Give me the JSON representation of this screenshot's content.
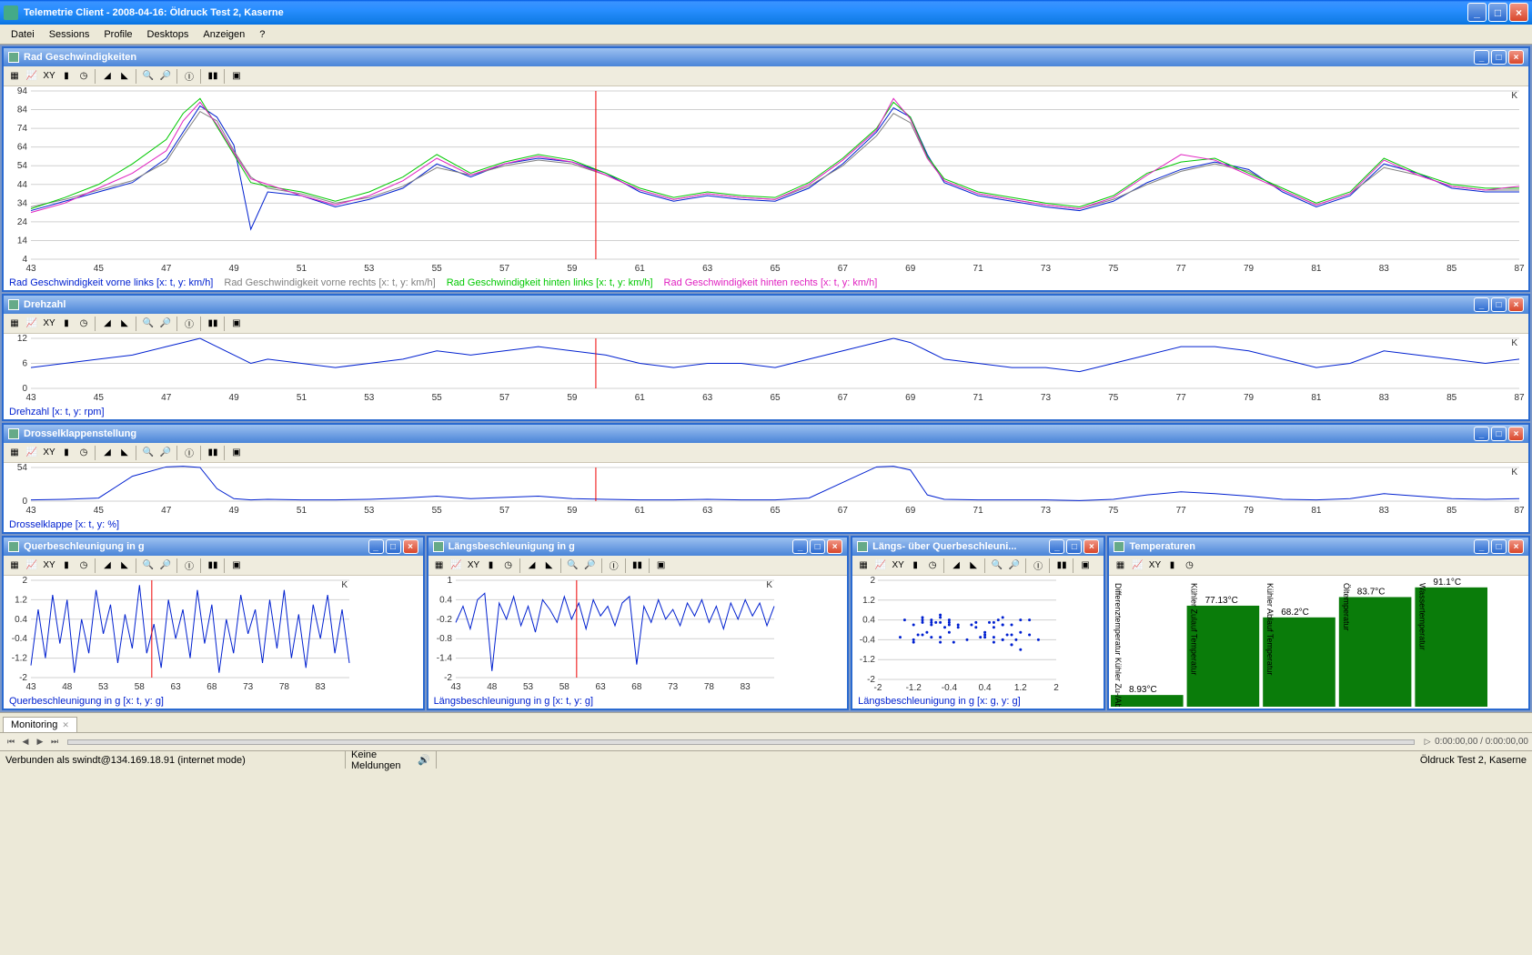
{
  "window": {
    "title": "Telemetrie Client - 2008-04-16: Öldruck Test 2, Kaserne"
  },
  "menu": [
    "Datei",
    "Sessions",
    "Profile",
    "Desktops",
    "Anzeigen",
    "?"
  ],
  "x_axis": {
    "min": 43,
    "max": 87,
    "ticks": [
      43,
      45,
      47,
      49,
      51,
      53,
      55,
      57,
      59,
      61,
      63,
      65,
      67,
      69,
      71,
      73,
      75,
      77,
      79,
      81,
      83,
      85,
      87
    ],
    "cursor": 59.7,
    "unit": "K"
  },
  "panels": {
    "speed": {
      "title": "Rad Geschwindigkeiten",
      "y": {
        "min": 4,
        "max": 94,
        "ticks": [
          4,
          14,
          24,
          34,
          44,
          54,
          64,
          74,
          84,
          94
        ]
      },
      "legend": [
        {
          "label": "Rad Geschwindigkeit vorne links [x: t, y: km/h]",
          "color": "#0020d0"
        },
        {
          "label": "Rad Geschwindigkeit vorne rechts [x: t, y: km/h]",
          "color": "#808080"
        },
        {
          "label": "Rad Geschwindigkeit hinten links [x: t, y: km/h]",
          "color": "#00c800"
        },
        {
          "label": "Rad Geschwindigkeit hinten rechts [x: t, y: km/h]",
          "color": "#e020c0"
        }
      ]
    },
    "rpm": {
      "title": "Drehzahl",
      "y": {
        "min": 0,
        "max": 12,
        "ticks": [
          0,
          6,
          12
        ]
      },
      "legend": [
        {
          "label": "Drehzahl [x: t, y: rpm]",
          "color": "#0020d0"
        }
      ]
    },
    "throttle": {
      "title": "Drosselklappenstellung",
      "y": {
        "min": 0,
        "max": 54,
        "ticks": [
          0,
          54
        ]
      },
      "legend": [
        {
          "label": "Drosselklappe [x: t, y: %]",
          "color": "#0020d0"
        }
      ]
    },
    "lat": {
      "title": "Querbeschleunigung in g",
      "y": {
        "min": -2,
        "max": 2,
        "ticks": [
          -2,
          -1.2,
          -0.4,
          0.4,
          1.2,
          2
        ]
      },
      "x_ticks": [
        43,
        48,
        53,
        58,
        63,
        68,
        73,
        78,
        83
      ],
      "legend": [
        {
          "label": "Querbeschleunigung in g [x: t, y: g]",
          "color": "#0020d0"
        }
      ]
    },
    "lon": {
      "title": "Längsbeschleunigung in g",
      "y": {
        "min": -2,
        "max": 1,
        "ticks": [
          -2,
          -1.4,
          -0.8,
          -0.2,
          0.4,
          1
        ]
      },
      "x_ticks": [
        43,
        48,
        53,
        58,
        63,
        68,
        73,
        78,
        83
      ],
      "legend": [
        {
          "label": "Längsbeschleunigung in g [x: t, y: g]",
          "color": "#0020d0"
        }
      ]
    },
    "scatter": {
      "title": "Längs- über Querbeschleuni...",
      "x": {
        "min": -2,
        "max": 2,
        "ticks": [
          -2,
          -1.2,
          -0.4,
          0.4,
          1.2,
          2
        ]
      },
      "y": {
        "min": -2,
        "max": 2,
        "ticks": [
          -2,
          -1.2,
          -0.4,
          0.4,
          1.2,
          2
        ]
      },
      "legend": [
        {
          "label": "Längsbeschleunigung in g [x: g, y: g]",
          "color": "#0020d0"
        }
      ]
    },
    "temp": {
      "title": "Temperaturen",
      "bars": [
        {
          "label": "Differenztemperatur Kühler Zu-/Ab",
          "value": 8.93,
          "text": "8.93°C"
        },
        {
          "label": "Kühler Zulauf Temperatur",
          "value": 77.13,
          "text": "77.13°C"
        },
        {
          "label": "Kühler Ablauf Temperatur",
          "value": 68.2,
          "text": "68.2°C"
        },
        {
          "label": "Öltemperatur",
          "value": 83.7,
          "text": "83.7°C"
        },
        {
          "label": "Wassertemperatur",
          "value": 91.1,
          "text": "91.1°C"
        }
      ],
      "max": 100
    }
  },
  "tabs": {
    "active": "Monitoring"
  },
  "playback": {
    "time": "0:00:00,00 / 0:00:00,00"
  },
  "status": {
    "conn": "Verbunden als swindt@134.169.18.91 (internet mode)",
    "msg": "Keine Meldungen",
    "right": "Öldruck Test 2, Kaserne"
  },
  "chart_data": {
    "type": "line_multi",
    "shared_x": [
      43,
      44,
      45,
      46,
      47,
      47.5,
      48,
      48.5,
      49,
      49.5,
      50,
      51,
      52,
      53,
      54,
      55,
      56,
      57,
      58,
      59,
      60,
      61,
      62,
      63,
      64,
      65,
      66,
      67,
      68,
      68.5,
      69,
      69.5,
      70,
      71,
      72,
      73,
      74,
      75,
      76,
      77,
      78,
      79,
      80,
      81,
      82,
      83,
      84,
      85,
      86,
      87
    ],
    "speed_series": [
      {
        "name": "vorne links",
        "color": "#0020d0",
        "y": [
          30,
          35,
          40,
          45,
          58,
          72,
          86,
          80,
          65,
          20,
          40,
          38,
          32,
          36,
          42,
          55,
          48,
          55,
          58,
          56,
          50,
          40,
          35,
          38,
          36,
          35,
          42,
          55,
          72,
          85,
          80,
          60,
          45,
          38,
          35,
          32,
          30,
          35,
          45,
          52,
          56,
          52,
          40,
          32,
          38,
          55,
          50,
          42,
          40,
          40
        ]
      },
      {
        "name": "vorne rechts",
        "color": "#808080",
        "y": [
          32,
          36,
          41,
          46,
          56,
          70,
          83,
          78,
          62,
          48,
          42,
          39,
          34,
          37,
          43,
          53,
          49,
          54,
          57,
          55,
          49,
          41,
          36,
          39,
          37,
          36,
          43,
          54,
          70,
          82,
          77,
          58,
          46,
          39,
          36,
          33,
          31,
          36,
          44,
          51,
          55,
          51,
          41,
          33,
          39,
          53,
          49,
          43,
          41,
          41
        ]
      },
      {
        "name": "hinten links",
        "color": "#00c800",
        "y": [
          31,
          37,
          44,
          55,
          68,
          82,
          90,
          75,
          60,
          45,
          43,
          40,
          35,
          40,
          48,
          60,
          50,
          56,
          60,
          57,
          50,
          42,
          37,
          40,
          38,
          37,
          45,
          58,
          74,
          88,
          80,
          59,
          47,
          40,
          37,
          34,
          32,
          38,
          50,
          56,
          58,
          50,
          42,
          34,
          40,
          58,
          50,
          44,
          42,
          42
        ]
      },
      {
        "name": "hinten rechts",
        "color": "#e020c0",
        "y": [
          29,
          34,
          42,
          50,
          62,
          78,
          88,
          76,
          61,
          47,
          44,
          38,
          33,
          38,
          46,
          58,
          49,
          55,
          59,
          56,
          49,
          41,
          36,
          39,
          37,
          36,
          44,
          57,
          73,
          90,
          79,
          58,
          46,
          39,
          36,
          33,
          31,
          37,
          49,
          60,
          57,
          49,
          41,
          33,
          39,
          57,
          49,
          43,
          41,
          43
        ]
      }
    ],
    "rpm": {
      "name": "Drehzahl",
      "color": "#0020d0",
      "y": [
        5,
        6,
        7,
        8,
        10,
        11,
        12,
        10,
        8,
        6,
        7,
        6,
        5,
        6,
        7,
        9,
        8,
        9,
        10,
        9,
        8,
        6,
        5,
        6,
        6,
        5,
        7,
        9,
        11,
        12,
        11,
        9,
        7,
        6,
        5,
        5,
        4,
        6,
        8,
        10,
        10,
        9,
        7,
        5,
        6,
        9,
        8,
        7,
        6,
        7
      ]
    },
    "throttle": {
      "name": "Drosselklappe",
      "color": "#0020d0",
      "y": [
        2,
        3,
        5,
        40,
        55,
        56,
        54,
        20,
        4,
        2,
        3,
        2,
        2,
        3,
        5,
        8,
        4,
        6,
        8,
        4,
        3,
        2,
        2,
        3,
        2,
        2,
        5,
        30,
        55,
        56,
        50,
        10,
        3,
        2,
        2,
        2,
        1,
        3,
        10,
        15,
        12,
        8,
        3,
        2,
        4,
        12,
        8,
        4,
        3,
        4
      ]
    },
    "lat_g": {
      "name": "Querbeschleunigung",
      "color": "#0020d0",
      "x": [
        43,
        44,
        45,
        46,
        47,
        48,
        49,
        50,
        51,
        52,
        53,
        54,
        55,
        56,
        57,
        58,
        59,
        60,
        61,
        62,
        63,
        64,
        65,
        66,
        67,
        68,
        69,
        70,
        71,
        72,
        73,
        74,
        75,
        76,
        77,
        78,
        79,
        80,
        81,
        82,
        83,
        84,
        85,
        86,
        87
      ],
      "y": [
        -1.5,
        0.8,
        -1.2,
        1.4,
        -0.6,
        1.2,
        -1.8,
        0.4,
        -1.0,
        1.6,
        -0.2,
        1.0,
        -1.4,
        0.6,
        -0.8,
        1.8,
        -1.0,
        0.2,
        -1.6,
        1.2,
        -0.4,
        0.8,
        -1.2,
        1.6,
        -0.6,
        1.0,
        -1.8,
        0.4,
        -1.0,
        1.4,
        -0.2,
        0.8,
        -1.4,
        1.2,
        -0.8,
        1.6,
        -1.2,
        0.6,
        -1.6,
        1.0,
        -0.4,
        1.4,
        -1.0,
        0.8,
        -1.4
      ]
    },
    "lon_g": {
      "name": "Längsbeschleunigung",
      "color": "#0020d0",
      "x": [
        43,
        44,
        45,
        46,
        47,
        48,
        49,
        50,
        51,
        52,
        53,
        54,
        55,
        56,
        57,
        58,
        59,
        60,
        61,
        62,
        63,
        64,
        65,
        66,
        67,
        68,
        69,
        70,
        71,
        72,
        73,
        74,
        75,
        76,
        77,
        78,
        79,
        80,
        81,
        82,
        83,
        84,
        85,
        86,
        87
      ],
      "y": [
        -0.3,
        0.2,
        -0.5,
        0.4,
        0.6,
        -1.8,
        0.3,
        -0.2,
        0.5,
        -0.4,
        0.2,
        -0.6,
        0.4,
        0.1,
        -0.3,
        0.5,
        -0.2,
        0.3,
        -0.5,
        0.4,
        -0.1,
        0.2,
        -0.4,
        0.3,
        0.5,
        -1.6,
        0.2,
        -0.3,
        0.4,
        -0.2,
        0.1,
        -0.4,
        0.3,
        -0.1,
        0.4,
        -0.3,
        0.2,
        -0.5,
        0.3,
        -0.2,
        0.4,
        -0.1,
        0.3,
        -0.4,
        0.2
      ]
    },
    "scatter": {
      "name": "Längs über Quer",
      "color": "#0020d0",
      "points": [
        [
          -1.5,
          -0.3
        ],
        [
          0.8,
          0.2
        ],
        [
          -1.2,
          -0.5
        ],
        [
          1.4,
          0.4
        ],
        [
          -0.6,
          0.6
        ],
        [
          1.2,
          -0.8
        ],
        [
          -0.8,
          0.3
        ],
        [
          0.4,
          -0.2
        ],
        [
          -1.0,
          0.5
        ],
        [
          1.6,
          -0.4
        ],
        [
          -0.2,
          0.2
        ],
        [
          1.0,
          -0.6
        ],
        [
          -1.4,
          0.4
        ],
        [
          0.6,
          0.1
        ],
        [
          -0.8,
          -0.3
        ],
        [
          0.8,
          0.5
        ],
        [
          -1.0,
          -0.2
        ],
        [
          0.2,
          0.3
        ],
        [
          -0.6,
          -0.5
        ],
        [
          1.2,
          0.4
        ],
        [
          -0.4,
          -0.1
        ],
        [
          0.8,
          0.2
        ],
        [
          -1.2,
          -0.4
        ],
        [
          0.6,
          0.3
        ],
        [
          -0.6,
          0.5
        ],
        [
          1.0,
          -0.6
        ],
        [
          -0.8,
          0.2
        ],
        [
          0.4,
          -0.3
        ],
        [
          -1.0,
          0.4
        ],
        [
          1.4,
          -0.2
        ],
        [
          -0.2,
          0.1
        ],
        [
          0.8,
          -0.4
        ],
        [
          -0.4,
          0.3
        ],
        [
          1.2,
          -0.1
        ],
        [
          -0.8,
          0.4
        ],
        [
          0.6,
          -0.3
        ],
        [
          -1.2,
          0.2
        ],
        [
          0.6,
          -0.5
        ],
        [
          -0.6,
          0.3
        ],
        [
          1.0,
          -0.2
        ],
        [
          -0.4,
          0.4
        ],
        [
          0.4,
          -0.1
        ],
        [
          -1.0,
          0.3
        ],
        [
          0.8,
          -0.4
        ],
        [
          -0.4,
          0.2
        ],
        [
          0.3,
          -0.3
        ],
        [
          -0.5,
          0.1
        ],
        [
          0.9,
          -0.2
        ],
        [
          -0.7,
          0.3
        ],
        [
          1.1,
          -0.4
        ],
        [
          0.1,
          0.2
        ],
        [
          -0.9,
          -0.1
        ],
        [
          0.5,
          0.3
        ],
        [
          -0.3,
          -0.5
        ],
        [
          0.7,
          0.4
        ],
        [
          -1.1,
          -0.2
        ],
        [
          0.2,
          0.1
        ],
        [
          -0.6,
          -0.3
        ],
        [
          1.0,
          0.2
        ],
        [
          0.0,
          -0.4
        ]
      ]
    }
  }
}
